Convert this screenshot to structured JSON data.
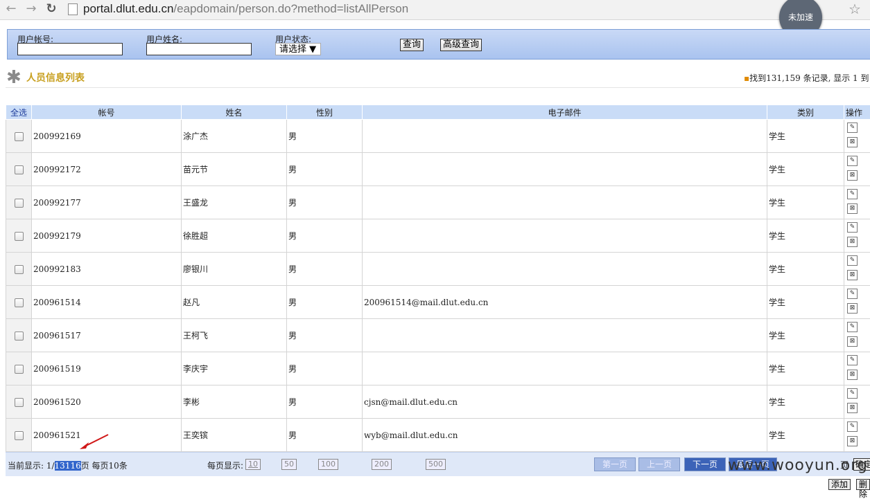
{
  "browser": {
    "url_host": "portal.dlut.edu.cn",
    "url_path": "/eapdomain/person.do?method=listAllPerson",
    "accel_badge": "未加速"
  },
  "search": {
    "account_label": "用户帐号:",
    "name_label": "用户姓名:",
    "status_label": "用户状态:",
    "status_selected": "请选择",
    "query_button": "查询",
    "advanced_button": "高级查询"
  },
  "list": {
    "title": "人员信息列表",
    "records_text": "找到131,159 条记录, 显示 1 到"
  },
  "table": {
    "headers": [
      "全选",
      "帐号",
      "姓名",
      "性别",
      "电子邮件",
      "类别",
      "操作"
    ],
    "rows": [
      {
        "account": "200992169",
        "name": "涂广杰",
        "gender": "男",
        "email": "",
        "type": "学生"
      },
      {
        "account": "200992172",
        "name": "苗元节",
        "gender": "男",
        "email": "",
        "type": "学生"
      },
      {
        "account": "200992177",
        "name": "王盛龙",
        "gender": "男",
        "email": "",
        "type": "学生"
      },
      {
        "account": "200992179",
        "name": "徐胜超",
        "gender": "男",
        "email": "",
        "type": "学生"
      },
      {
        "account": "200992183",
        "name": "廖银川",
        "gender": "男",
        "email": "",
        "type": "学生"
      },
      {
        "account": "200961514",
        "name": "赵凡",
        "gender": "男",
        "email": "200961514@mail.dlut.edu.cn",
        "type": "学生"
      },
      {
        "account": "200961517",
        "name": "王柯飞",
        "gender": "男",
        "email": "",
        "type": "学生"
      },
      {
        "account": "200961519",
        "name": "李庆宇",
        "gender": "男",
        "email": "",
        "type": "学生"
      },
      {
        "account": "200961520",
        "name": "李彬",
        "gender": "男",
        "email": "cjsn@mail.dlut.edu.cn",
        "type": "学生"
      },
      {
        "account": "200961521",
        "name": "王奕镔",
        "gender": "男",
        "email": "wyb@mail.dlut.edu.cn",
        "type": "学生"
      }
    ]
  },
  "pager": {
    "current_prefix": "当前显示: 1/",
    "total_pages": "13116",
    "page_suffix": "页 每页10条",
    "per_page_label": "每页显示:",
    "sizes": [
      "10",
      "50",
      "100",
      "200",
      "500"
    ],
    "first": "第一页",
    "prev": "上一页",
    "next": "下一页",
    "last": "最后一页",
    "tail": "页",
    "go": "确定"
  },
  "footer": {
    "add": "添加",
    "delete": "删除"
  },
  "watermark": "www.wooyun.org"
}
